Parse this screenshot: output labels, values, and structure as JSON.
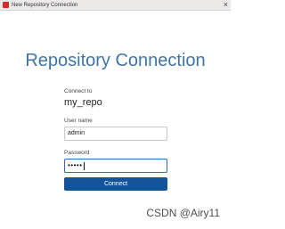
{
  "window": {
    "title": "New Repository Connection",
    "close_glyph": "×"
  },
  "dialog": {
    "heading": "Repository Connection",
    "connect_to_label": "Connect to",
    "repository_name": "my_repo",
    "username_label": "User name",
    "username_value": "admin",
    "password_label": "Password",
    "password_masked": "•••••",
    "connect_button": "Connect"
  },
  "watermark": "CSDN @Airy11",
  "colors": {
    "accent": "#13559a",
    "heading": "#3f74a8",
    "focus_border": "#2f6db0"
  }
}
